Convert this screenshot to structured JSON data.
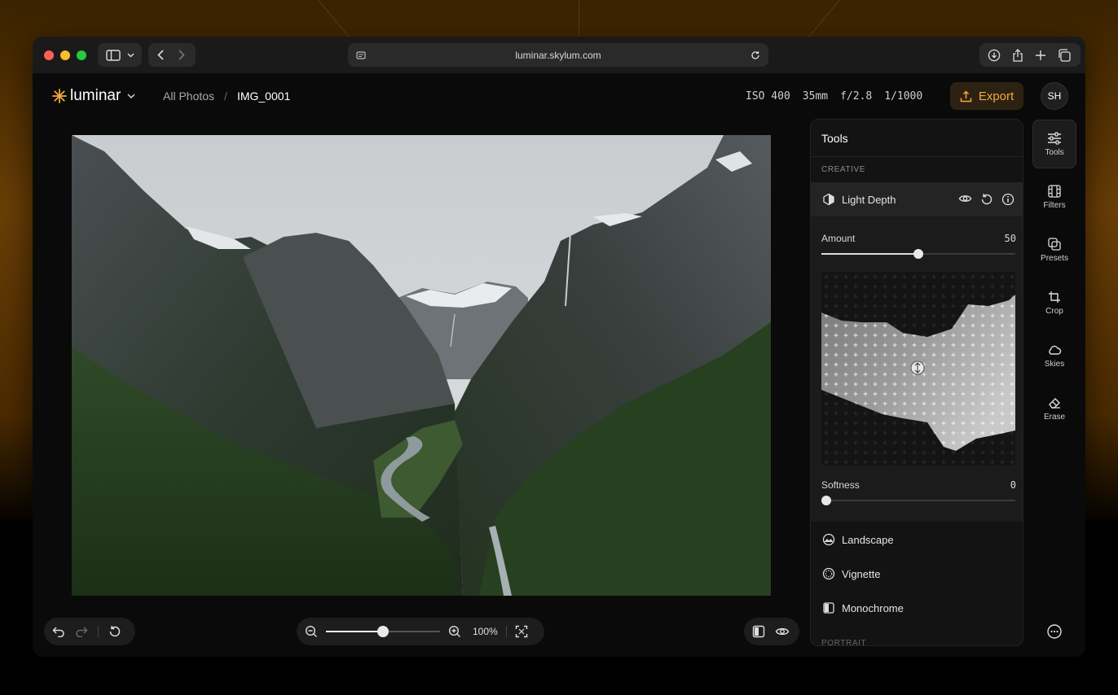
{
  "browser": {
    "url": "luminar.skylum.com"
  },
  "header": {
    "logo": "luminar",
    "breadcrumb": {
      "root": "All Photos",
      "separator": "/",
      "current": "IMG_0001"
    },
    "exif": {
      "iso": "ISO 400",
      "focal_length": "35mm",
      "aperture": "f/2.8",
      "shutter": "1/1000"
    },
    "export_label": "Export",
    "avatar_initials": "SH"
  },
  "zoom": {
    "value_label": "100%",
    "level": 0.5
  },
  "tools_panel": {
    "title": "Tools",
    "section_creative": "CREATIVE",
    "active_tool": {
      "label": "Light Depth",
      "amount_label": "Amount",
      "amount_value": "50",
      "amount_level": 0.5,
      "softness_label": "Softness",
      "softness_value": "0",
      "softness_level": 0
    },
    "tools": [
      {
        "label": "Landscape",
        "icon": "landscape-icon"
      },
      {
        "label": "Vignette",
        "icon": "vignette-icon"
      },
      {
        "label": "Monochrome",
        "icon": "monochrome-icon"
      }
    ],
    "next_section": "PORTRAIT"
  },
  "rail": [
    {
      "label": "Tools",
      "icon": "sliders-icon"
    },
    {
      "label": "Filters",
      "icon": "film-icon"
    },
    {
      "label": "Presets",
      "icon": "presets-icon"
    },
    {
      "label": "Crop",
      "icon": "crop-icon"
    },
    {
      "label": "Skies",
      "icon": "cloud-icon"
    },
    {
      "label": "Erase",
      "icon": "eraser-icon"
    }
  ],
  "colors": {
    "accent": "#f2a93b",
    "export_bg": "#2d2212"
  }
}
